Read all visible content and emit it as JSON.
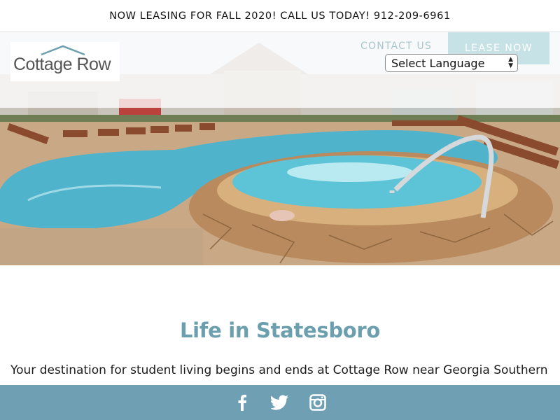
{
  "announcement": {
    "text": "NOW LEASING FOR FALL 2020! CALL US TODAY! 912-209-6961"
  },
  "header": {
    "logo_text": "Cottage Row",
    "nav": {
      "contact_label": "CONTACT US",
      "lease_label": "LEASE NOW"
    },
    "language_select": {
      "selected": "Select Language"
    }
  },
  "content": {
    "title": "Life in Statesboro",
    "intro": "Your destination for student living begins and ends at Cottage Row near Georgia Southern"
  },
  "footer": {
    "social": [
      "facebook-icon",
      "twitter-icon",
      "instagram-icon"
    ]
  },
  "colors": {
    "accent": "#6b9fae",
    "footer_bg": "#6e9fb3",
    "lease_button_bg": "#c7e2e6"
  }
}
